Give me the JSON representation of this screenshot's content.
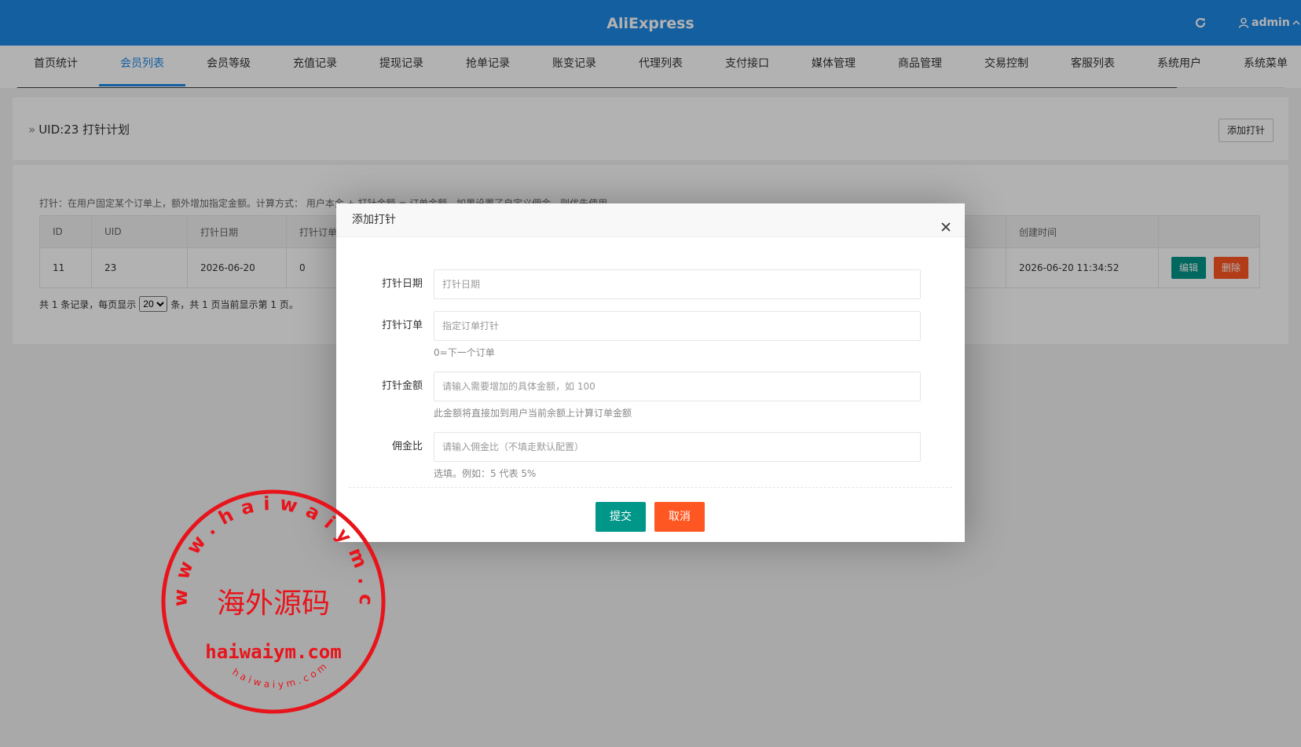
{
  "header": {
    "title": "AliExpress",
    "user": "admin"
  },
  "nav": {
    "items": [
      {
        "label": "首页统计"
      },
      {
        "label": "会员列表"
      },
      {
        "label": "会员等级"
      },
      {
        "label": "充值记录"
      },
      {
        "label": "提现记录"
      },
      {
        "label": "抢单记录"
      },
      {
        "label": "账变记录"
      },
      {
        "label": "代理列表"
      },
      {
        "label": "支付接口"
      },
      {
        "label": "媒体管理"
      },
      {
        "label": "商品管理"
      },
      {
        "label": "交易控制"
      },
      {
        "label": "客服列表"
      },
      {
        "label": "系统用户"
      },
      {
        "label": "系统菜单"
      }
    ],
    "active": "会员列表"
  },
  "page": {
    "crumb_marker": "»",
    "title": "UID:23 打针计划",
    "add_button": "添加打针",
    "hint": "打针：在用户固定某个订单上，额外增加指定金额。计算方式：  用户本金 + 打针金额 = 订单金额。如果设置了自定义佣金，则优先使用。",
    "table": {
      "headers": [
        "ID",
        "UID",
        "打针日期",
        "打针订单",
        "",
        "创建时间",
        ""
      ],
      "rows": [
        {
          "id": "11",
          "uid": "23",
          "date": "2026-06-20",
          "order": "0",
          "created": "2026-06-20 11:34:52",
          "edit": "编辑",
          "delete": "删除"
        }
      ]
    },
    "pager": {
      "prefix": "共 1 条记录，每页显示",
      "page_size": "20",
      "page_size_options": [
        "20"
      ],
      "suffix": "条，共 1 页当前显示第 1 页。"
    }
  },
  "modal": {
    "title": "添加打针",
    "fields": {
      "date": {
        "label": "打针日期",
        "placeholder": "打针日期",
        "tip": ""
      },
      "order": {
        "label": "打针订单",
        "placeholder": "指定订单打针",
        "tip": "0=下一个订单"
      },
      "amount": {
        "label": "打针金额",
        "placeholder": "请输入需要增加的具体金额，如 100",
        "tip": "此金额将直接加到用户当前余额上计算订单金额"
      },
      "commission": {
        "label": "佣金比",
        "placeholder": "请输入佣金比（不填走默认配置）",
        "tip": "选填。例如：5 代表 5%"
      }
    },
    "submit": "提交",
    "cancel": "取消"
  },
  "stamp": {
    "outer_text": "www.haiwaiym.com",
    "center_text": "海外源码",
    "line_text": "haiwaiym.com",
    "inner_text": "haiwaiym.com",
    "color": "#e8141b"
  },
  "colors": {
    "header": "#1e88e5",
    "primary": "#009688",
    "danger": "#ff5722"
  }
}
